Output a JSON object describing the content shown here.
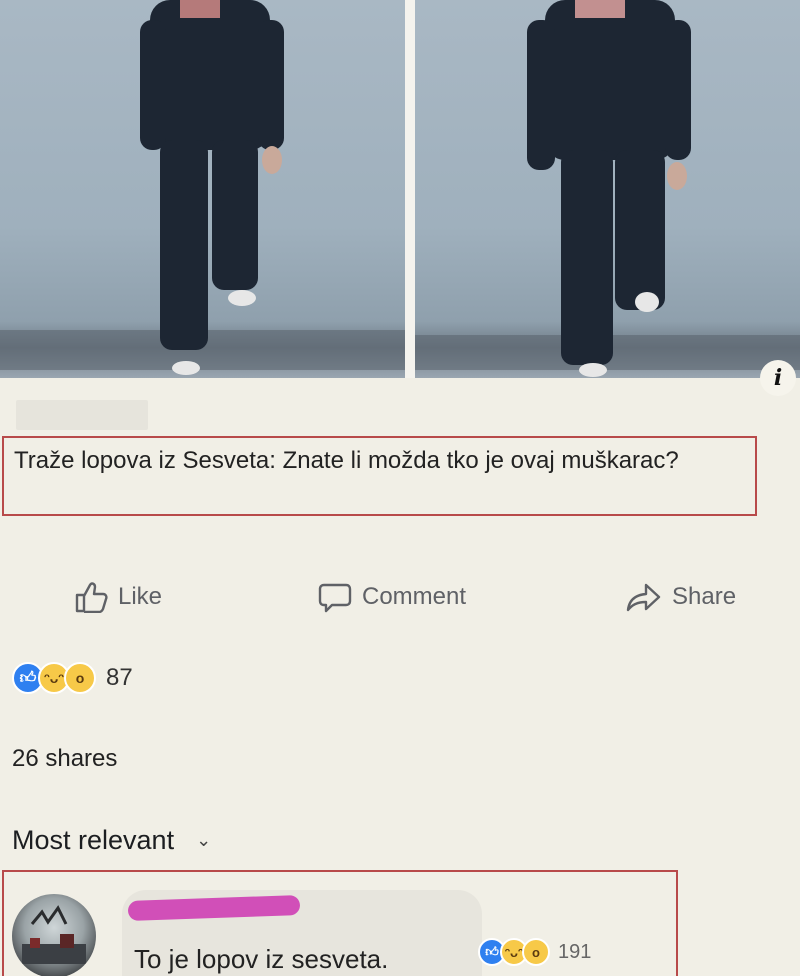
{
  "post": {
    "text": "Traže lopova iz Sesveta: Znate li možda tko je ovaj muškarac?",
    "info_icon": "i"
  },
  "actions": {
    "like": "Like",
    "comment": "Comment",
    "share": "Share"
  },
  "reactions": {
    "count": "87",
    "icons": [
      "like-icon",
      "haha-icon",
      "wow-icon"
    ]
  },
  "shares": "26 shares",
  "comments_sort": {
    "label": "Most relevant"
  },
  "comment": {
    "text": "To je lopov iz sesveta.",
    "reaction_count": "191"
  },
  "colors": {
    "highlight_border": "#b84a4a",
    "like_blue": "#2f80f0",
    "name_scribble": "#d14fb8"
  }
}
